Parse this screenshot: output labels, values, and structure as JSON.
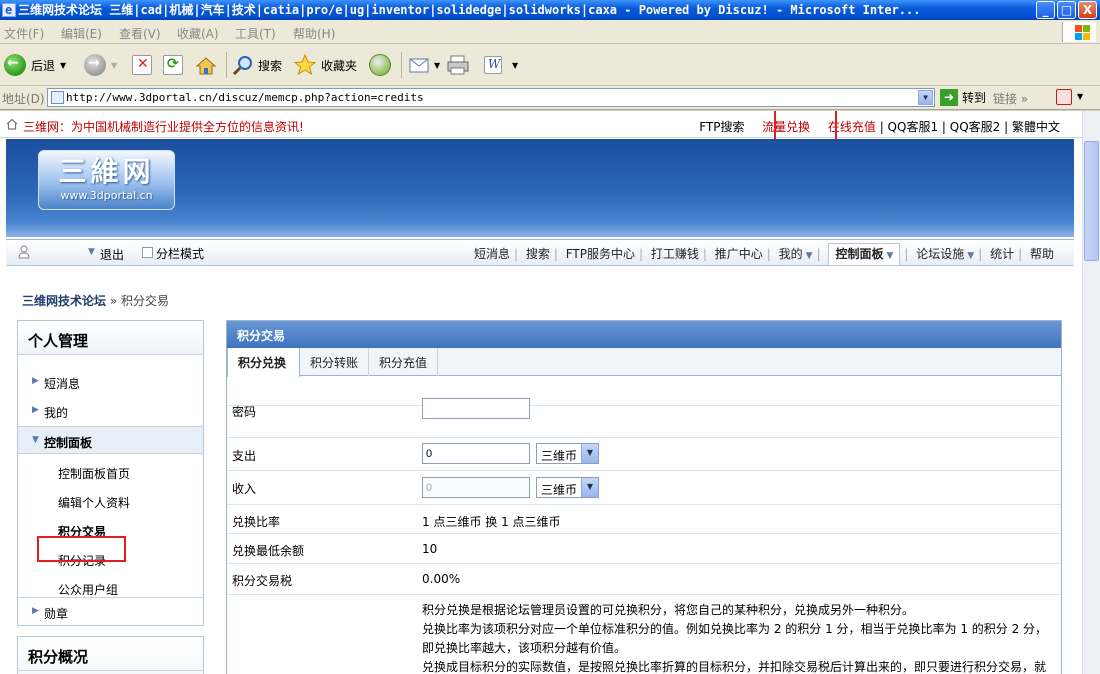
{
  "window": {
    "title": "三维网技术论坛 三维|cad|机械|汽车|技术|catia|pro/e|ug|inventor|solidedge|solidworks|caxa - Powered by Discuz! - Microsoft Inter...",
    "min": "_",
    "max": "□",
    "close": "X"
  },
  "menu": [
    "文件(F)",
    "编辑(E)",
    "查看(V)",
    "收藏(A)",
    "工具(T)",
    "帮助(H)"
  ],
  "toolbar": {
    "back": "后退",
    "search": "搜索",
    "favorites": "收藏夹"
  },
  "address": {
    "label": "地址(D)",
    "url": "http://www.3dportal.cn/discuz/memcp.php?action=credits",
    "go": "转到",
    "links": "链接"
  },
  "site": {
    "slogan": "三维网：为中国机械制造行业提供全方位的信息资讯!",
    "toplinks": {
      "ftp_search": "FTP搜索",
      "traffic_exchange": "流量兑换",
      "online_recharge": "在线充值",
      "qq1": "QQ客服1",
      "qq2": "QQ客服2",
      "trad_chinese": "繁體中文"
    },
    "logo_big": "三維网",
    "logo_small": "www.3dportal.cn"
  },
  "nav": {
    "logout": "退出",
    "column_mode": "分栏模式",
    "links": [
      "短消息",
      "搜索",
      "FTP服务中心",
      "打工赚钱",
      "推广中心",
      "我的"
    ],
    "control_panel": "控制面板",
    "forum_settings": "论坛设施",
    "stats": "统计",
    "help": "帮助"
  },
  "breadcrumb": {
    "root": "三维网技术论坛",
    "rest": "» 积分交易"
  },
  "sidebar": {
    "title": "个人管理",
    "items": {
      "messages": "短消息",
      "mine": "我的",
      "control_panel": "控制面板",
      "rewards": "勋章"
    },
    "subs": {
      "cp_home": "控制面板首页",
      "edit_profile": "编辑个人资料",
      "credit_trade": "积分交易",
      "credit_log": "积分记录",
      "public_groups": "公众用户组"
    },
    "panel2_title": "积分概况"
  },
  "main": {
    "title": "积分交易",
    "tabs": [
      "积分兑换",
      "积分转账",
      "积分充值"
    ],
    "password_label": "密码",
    "pay_label": "支出",
    "pay_value": "0",
    "pay_unit": "三维币",
    "income_label": "收入",
    "income_value": "0",
    "income_unit": "三维币",
    "ratio_label": "兑换比率",
    "ratio_value": "1 点三维币 换 1 点三维币",
    "min_balance_label": "兑换最低余额",
    "min_balance_value": "10",
    "tax_label": "积分交易税",
    "tax_value": "0.00%",
    "desc": [
      "积分兑换是根据论坛管理员设置的可兑换积分，将您自己的某种积分，兑换成另外一种积分。",
      "兑换比率为该项积分对应一个单位标准积分的值。例如兑换比率为 2 的积分 1 分，相当于兑换比率为 1 的积分 2 分，即兑换比率越大，该项积分越有价值。",
      "兑换成目标积分的实际数值，是按照兑换比率折算的目标积分，并扣除交易税后计算出来的，即只要进行积分交易，就可能会产生交易损失。"
    ]
  }
}
